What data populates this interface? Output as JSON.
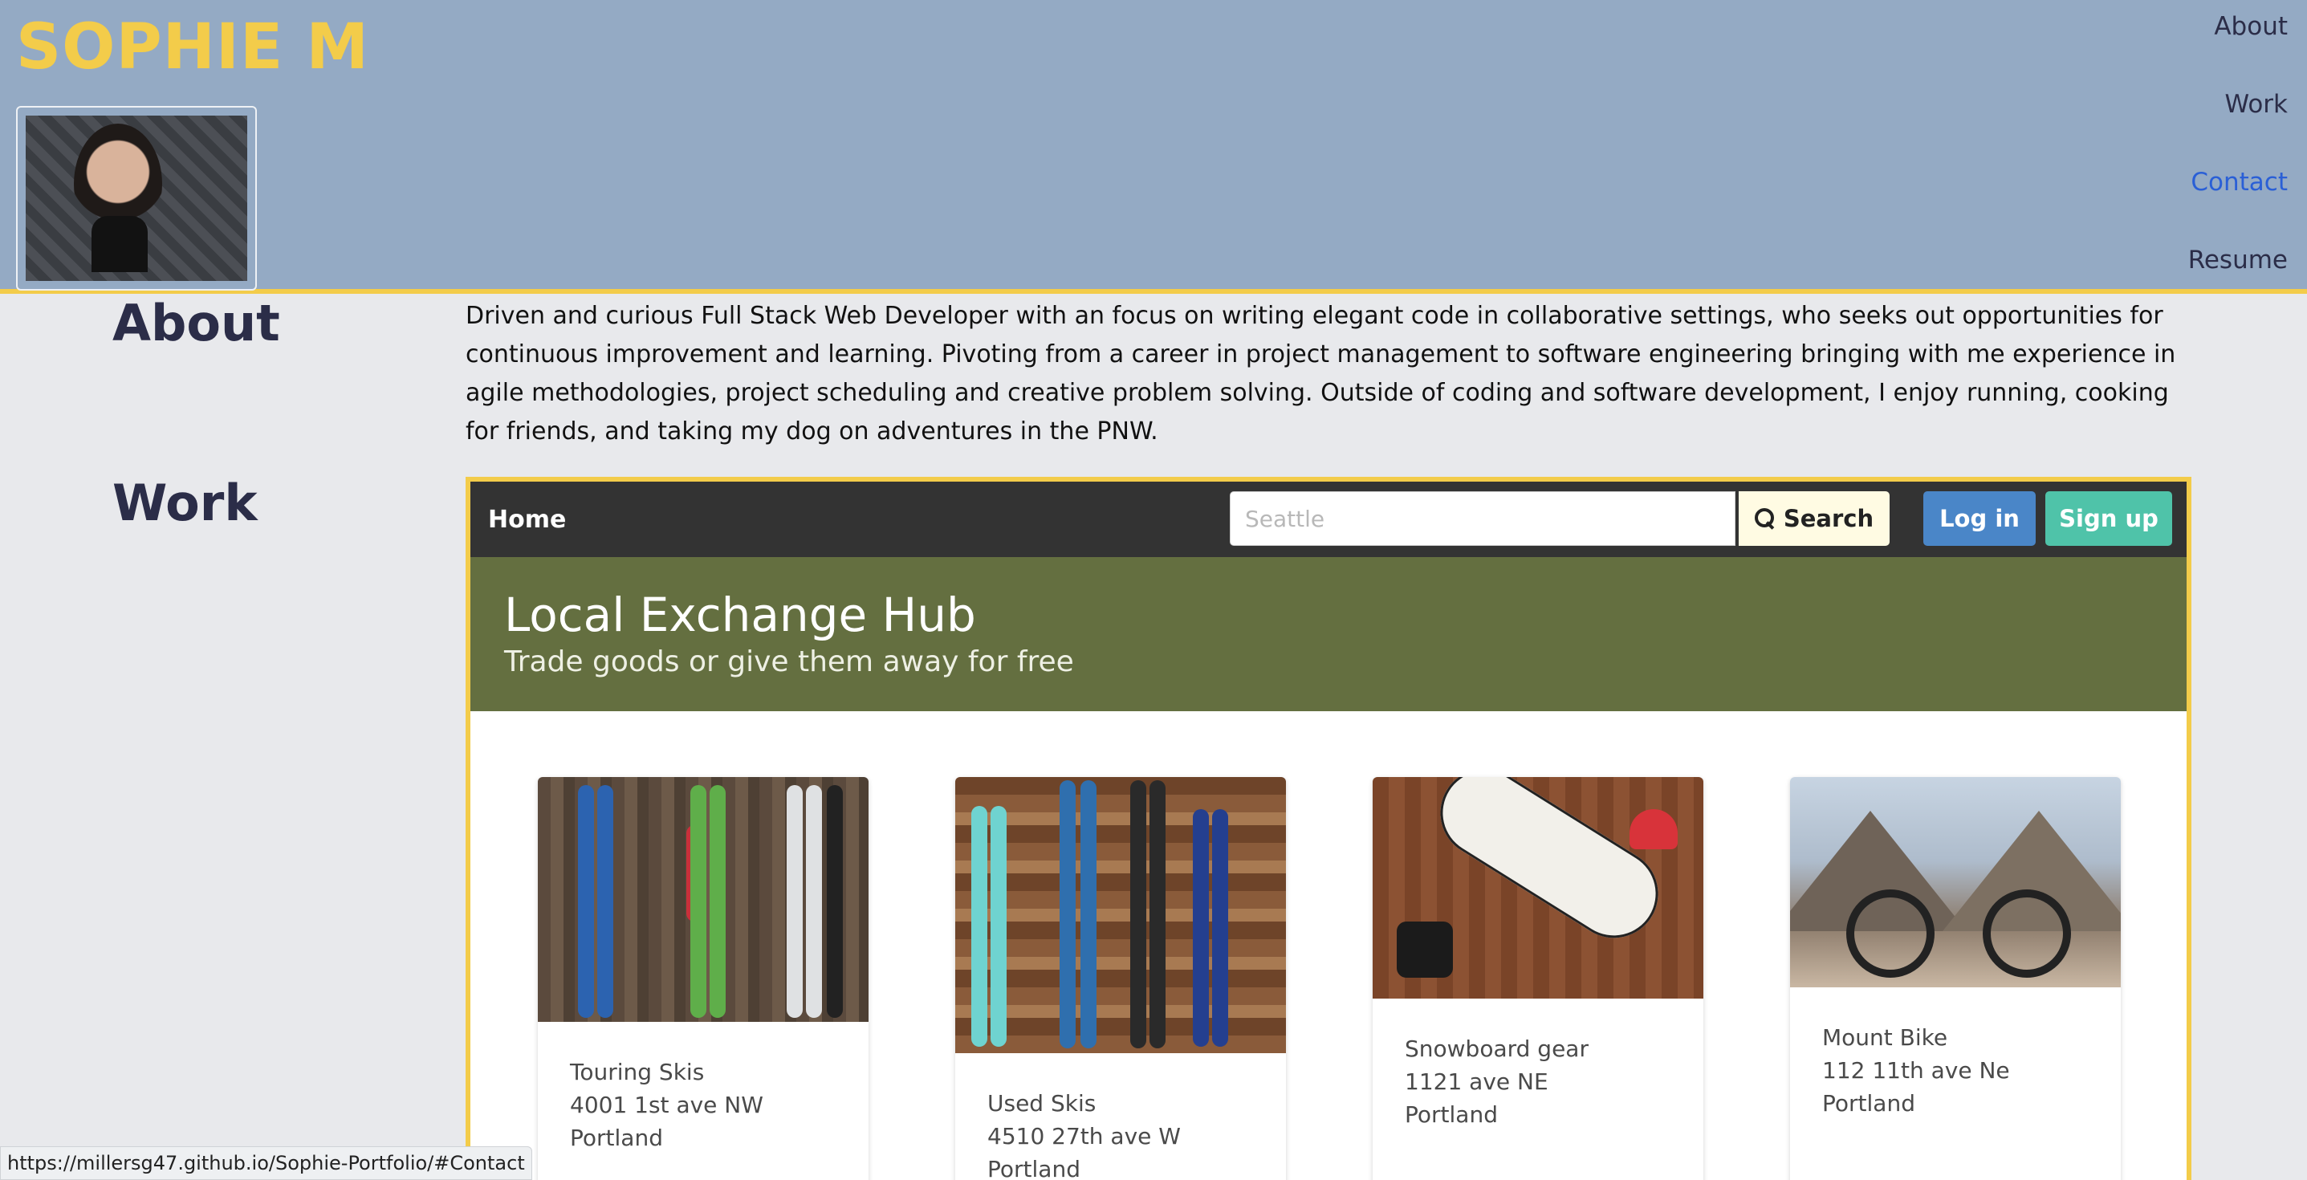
{
  "header": {
    "site_title": "SOPHIE M",
    "nav": [
      "About",
      "Work",
      "Contact",
      "Resume"
    ],
    "active_nav": "Contact"
  },
  "about": {
    "heading": "About",
    "text": "Driven and curious Full Stack Web Developer with an focus on writing elegant code in collaborative settings, who seeks out opportunities for continuous improvement and learning. Pivoting from a career in project management to software engineering bringing with me experience in agile methodologies, project scheduling and creative problem solving. Outside of coding and software development, I enjoy running, cooking for friends, and taking my dog on adventures in the PNW."
  },
  "work": {
    "heading": "Work",
    "app": {
      "home_label": "Home",
      "search_placeholder": "Seattle",
      "search_label": "Search",
      "login_label": "Log in",
      "signup_label": "Sign up",
      "hero_title": "Local Exchange Hub",
      "hero_subtitle": "Trade goods or give them away for free",
      "listings": [
        {
          "title": "Touring Skis",
          "address": "4001 1st ave NW",
          "city": "Portland"
        },
        {
          "title": "Used Skis",
          "address": "4510 27th ave W",
          "city": "Portland"
        },
        {
          "title": "Snowboard gear",
          "address": "1121 ave NE",
          "city": "Portland"
        },
        {
          "title": "Mount Bike",
          "address": "112 11th ave Ne",
          "city": "Portland"
        }
      ]
    }
  },
  "status_bar": {
    "url": "https://millersg47.github.io/Sophie-Portfolio/#Contact"
  },
  "colors": {
    "header_bg": "#94aac4",
    "accent_yellow": "#f3cc4a",
    "hero_green": "#646f40",
    "login_blue": "#4a86c8",
    "signup_teal": "#4fc3a9"
  }
}
